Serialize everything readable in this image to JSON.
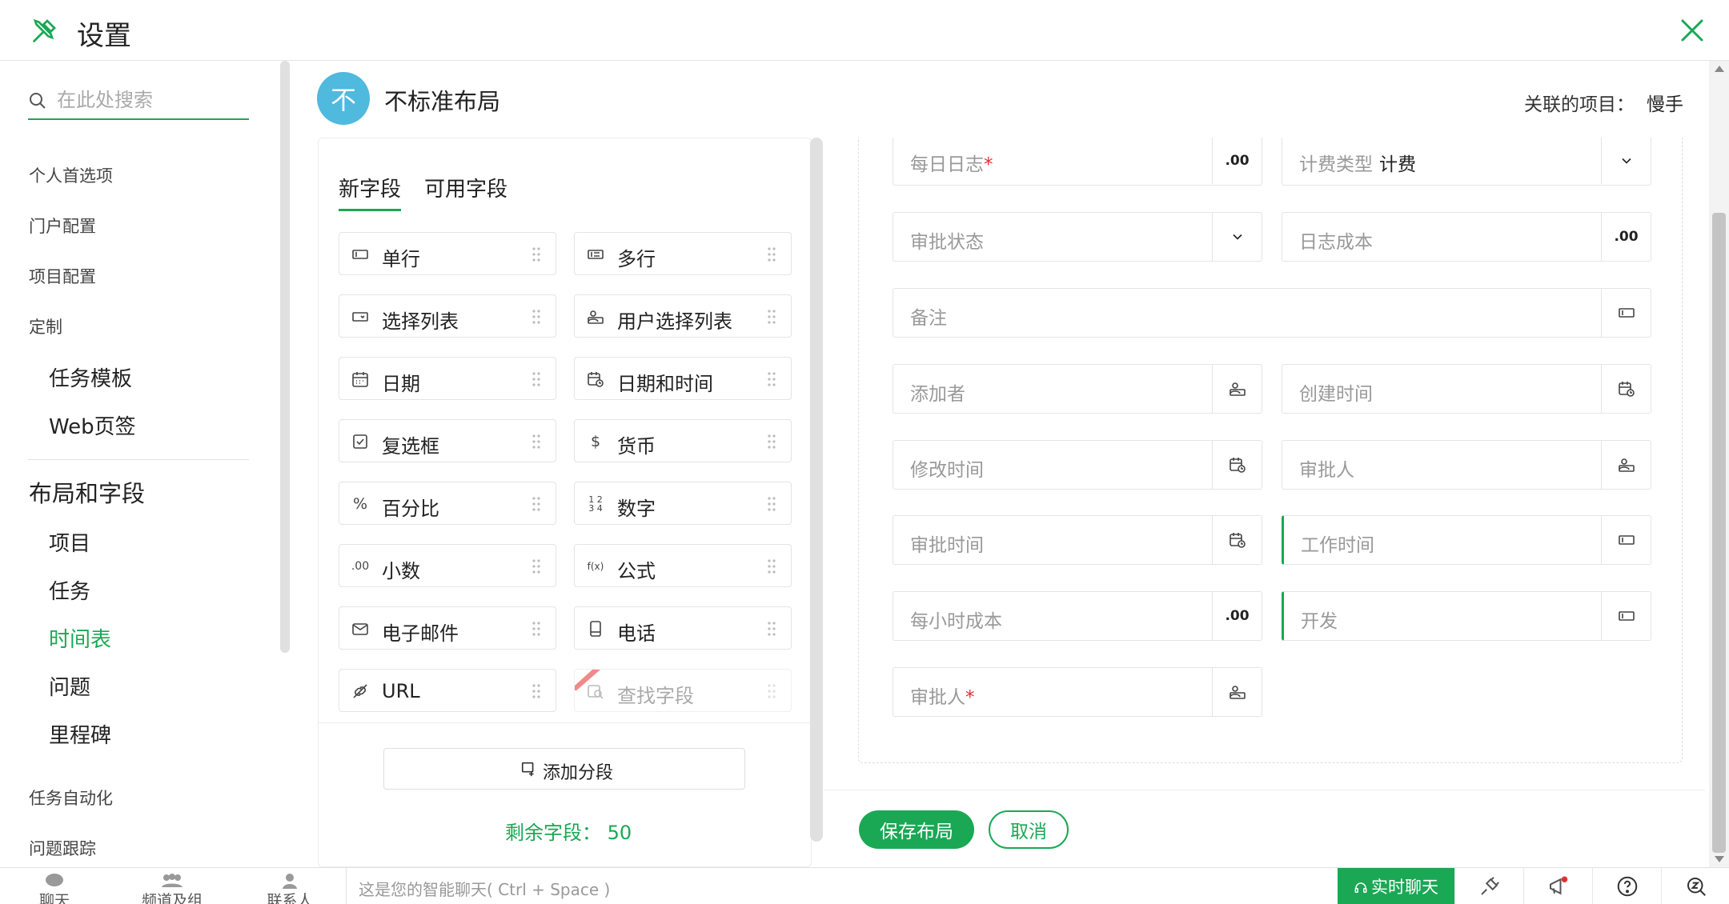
{
  "header": {
    "title": "设置"
  },
  "sidebar": {
    "search_placeholder": "在此处搜索",
    "items": [
      {
        "label": "个人首选项"
      },
      {
        "label": "门户配置"
      },
      {
        "label": "项目配置"
      },
      {
        "label": "定制"
      }
    ],
    "custom_sub": [
      {
        "label": "任务模板"
      },
      {
        "label": "Web页签"
      }
    ],
    "layout_section": "布局和字段",
    "layout_sub": [
      {
        "label": "项目"
      },
      {
        "label": "任务"
      },
      {
        "label": "时间表"
      },
      {
        "label": "问题"
      },
      {
        "label": "里程碑"
      }
    ],
    "active_item": "时间表",
    "bottom_items": [
      {
        "label": "任务自动化"
      },
      {
        "label": "问题跟踪"
      }
    ]
  },
  "layout": {
    "avatar_letter": "不",
    "name": "不标准布局",
    "related_label": "关联的项目：",
    "related_value": "慢手"
  },
  "palette": {
    "tabs": [
      "新字段",
      "可用字段"
    ],
    "active_tab": "新字段",
    "fields": [
      {
        "label": "单行",
        "icon": "single-line-icon"
      },
      {
        "label": "多行",
        "icon": "multi-line-icon"
      },
      {
        "label": "选择列表",
        "icon": "picklist-icon"
      },
      {
        "label": "用户选择列表",
        "icon": "user-picklist-icon"
      },
      {
        "label": "日期",
        "icon": "calendar-icon"
      },
      {
        "label": "日期和时间",
        "icon": "datetime-icon"
      },
      {
        "label": "复选框",
        "icon": "checkbox-icon"
      },
      {
        "label": "货币",
        "icon": "currency-icon",
        "glyph": "$"
      },
      {
        "label": "百分比",
        "icon": "percent-icon",
        "glyph": "%"
      },
      {
        "label": "数字",
        "icon": "number-icon",
        "glyph": "1 2\n3 4"
      },
      {
        "label": "小数",
        "icon": "decimal-icon",
        "glyph": ".00"
      },
      {
        "label": "公式",
        "icon": "formula-icon",
        "glyph": "f(x)"
      },
      {
        "label": "电子邮件",
        "icon": "email-icon"
      },
      {
        "label": "电话",
        "icon": "phone-icon"
      },
      {
        "label": "URL",
        "icon": "link-icon"
      },
      {
        "label": "查找字段",
        "icon": "lookup-icon"
      }
    ],
    "add_section": "添加分段",
    "remaining": "剩余字段：  50"
  },
  "form": {
    "fields": [
      {
        "label": "每日日志",
        "required": true,
        "suffix": ".00"
      },
      {
        "label": "计费类型",
        "value": "计费",
        "suffix": "chevron"
      },
      {
        "label": "审批状态",
        "suffix": "chevron"
      },
      {
        "label": "日志成本",
        "suffix": ".00"
      },
      {
        "label": "备注",
        "suffix": "text"
      },
      {
        "label": "添加者",
        "suffix": "user"
      },
      {
        "label": "创建时间",
        "suffix": "datetime"
      },
      {
        "label": "修改时间",
        "suffix": "datetime"
      },
      {
        "label": "审批人",
        "suffix": "user"
      },
      {
        "label": "审批时间",
        "suffix": "datetime"
      },
      {
        "label": "工作时间",
        "suffix": "text"
      },
      {
        "label": "每小时成本",
        "suffix": ".00"
      },
      {
        "label": "开发",
        "suffix": "text"
      },
      {
        "label": "审批人",
        "required": true,
        "suffix": "user"
      }
    ],
    "save": "保存布局",
    "cancel": "取消"
  },
  "bottombar": {
    "tabs": [
      "聊天",
      "频道及组",
      "联系人"
    ],
    "chat_placeholder": "这是您的智能聊天( Ctrl + Space )",
    "live_chat": "实时聊天"
  },
  "colors": {
    "accent": "#1aa854",
    "avatar": "#4fb9de",
    "required": "#e03131"
  }
}
